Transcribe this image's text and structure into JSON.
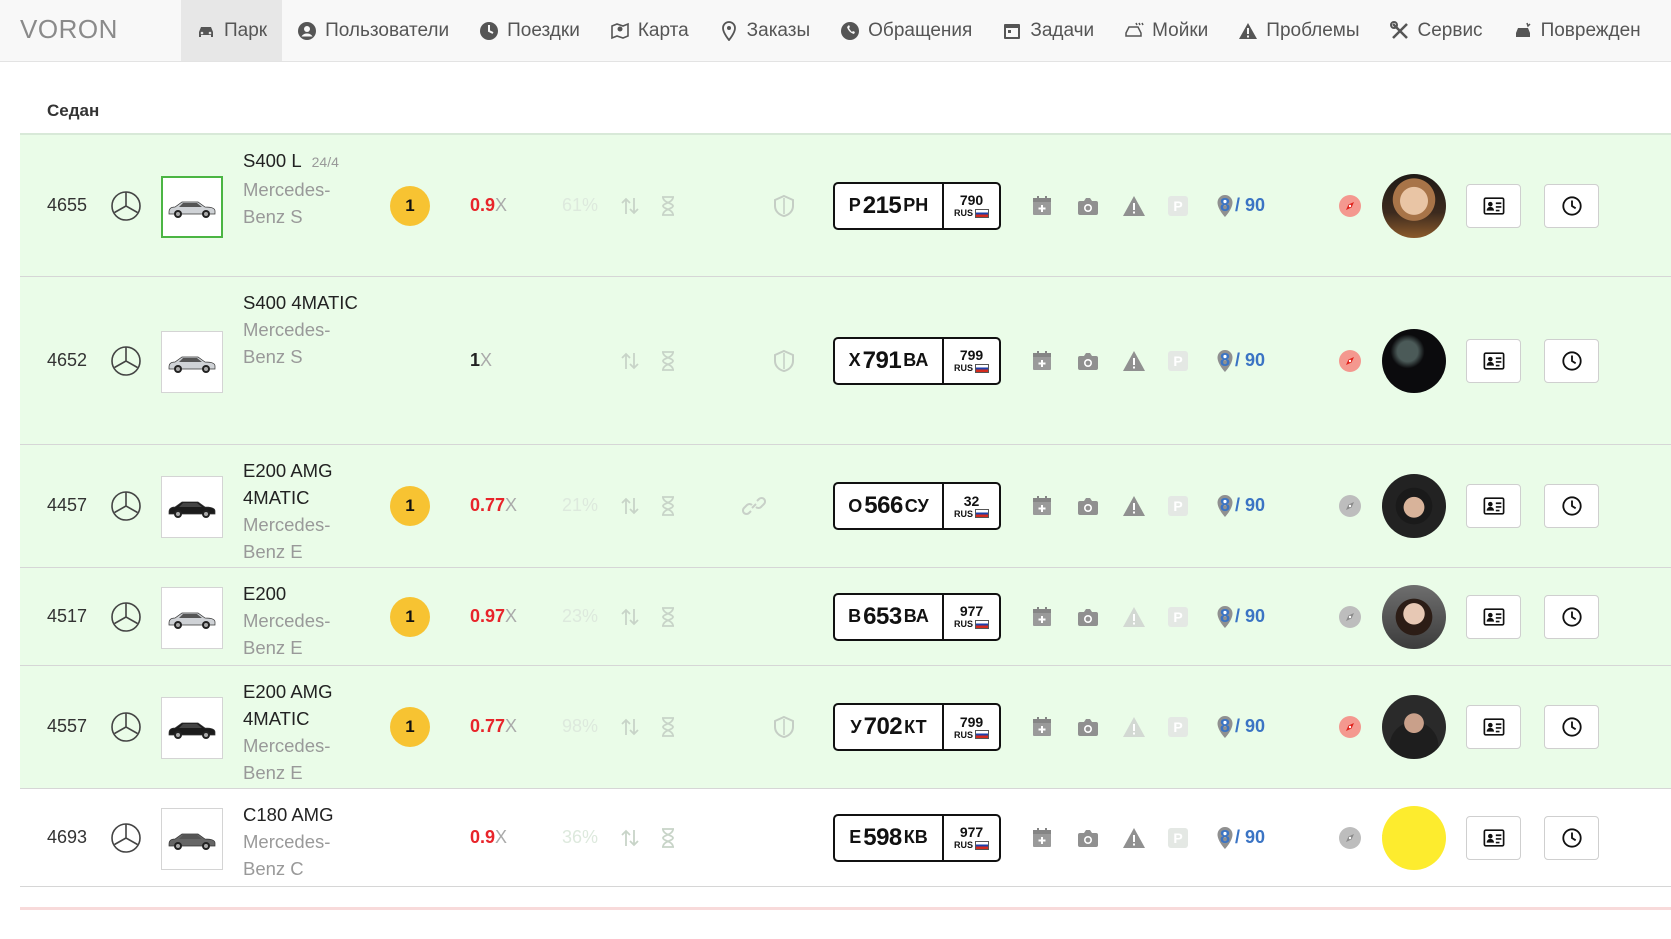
{
  "brand": "VORON",
  "nav": [
    {
      "label": "Парк",
      "icon": "car-icon",
      "active": true
    },
    {
      "label": "Пользователи",
      "icon": "user-circle-icon"
    },
    {
      "label": "Поездки",
      "icon": "clock-icon"
    },
    {
      "label": "Карта",
      "icon": "map-icon"
    },
    {
      "label": "Заказы",
      "icon": "map-pin-icon"
    },
    {
      "label": "Обращения",
      "icon": "phone-icon"
    },
    {
      "label": "Задачи",
      "icon": "calendar-icon"
    },
    {
      "label": "Мойки",
      "icon": "wash-icon"
    },
    {
      "label": "Проблемы",
      "icon": "warning-icon"
    },
    {
      "label": "Сервис",
      "icon": "tools-icon"
    },
    {
      "label": "Поврежден",
      "icon": "crash-icon"
    }
  ],
  "section": "Седан",
  "rows": [
    {
      "id": "4655",
      "model": "S400 L",
      "schedule": "24/4",
      "brand": "Mercedes-Benz S",
      "car_color": "silver",
      "selected": true,
      "badge": "1",
      "coef": "0.9",
      "coef_color": "#e8242a",
      "coef_x": "X",
      "percent": "61%",
      "shield": true,
      "link": false,
      "plate": {
        "letter1": "Р",
        "digits": "215",
        "letters2": "РН",
        "region": "790",
        "rus": "RUS"
      },
      "warning_active": true,
      "counter": "8 / 90",
      "compass": "red",
      "extra": "oil-orange",
      "avatar": "woman-blonde",
      "green": true
    },
    {
      "id": "4652",
      "model": "S400 4MATIC",
      "schedule": "",
      "brand": "Mercedes-Benz S",
      "car_color": "silver",
      "selected": false,
      "badge": "",
      "coef": "1",
      "coef_color": "#222",
      "coef_x": "X",
      "percent": "",
      "shield": true,
      "link": false,
      "plate": {
        "letter1": "Х",
        "digits": "791",
        "letters2": "ВА",
        "region": "799",
        "rus": "RUS"
      },
      "warning_active": true,
      "counter": "8 / 90",
      "compass": "red",
      "extra": "fuel-gray",
      "avatar": "dark",
      "green": true
    },
    {
      "id": "4457",
      "model": "E200 AMG 4MATIC",
      "schedule": "",
      "brand": "Mercedes-Benz E",
      "car_color": "black",
      "selected": false,
      "badge": "1",
      "coef": "0.77",
      "coef_color": "#e8242a",
      "coef_x": "X",
      "percent": "21%",
      "shield": false,
      "link": true,
      "plate": {
        "letter1": "О",
        "digits": "566",
        "letters2": "СУ",
        "region": "32",
        "rus": "RUS"
      },
      "warning_active": true,
      "counter": "8 / 90",
      "compass": "gray",
      "extra": "",
      "avatar": "man-hood",
      "green": true
    },
    {
      "id": "4517",
      "model": "E200",
      "schedule": "",
      "brand": "Mercedes-Benz E",
      "car_color": "silver",
      "selected": false,
      "badge": "1",
      "coef": "0.97",
      "coef_color": "#e8242a",
      "coef_x": "X",
      "percent": "23%",
      "shield": false,
      "link": false,
      "plate": {
        "letter1": "В",
        "digits": "653",
        "letters2": "ВА",
        "region": "977",
        "rus": "RUS"
      },
      "warning_active": false,
      "counter": "8 / 90",
      "compass": "gray",
      "extra": "",
      "avatar": "woman-brunette",
      "green": true
    },
    {
      "id": "4557",
      "model": "E200 AMG 4MATIC",
      "schedule": "",
      "brand": "Mercedes-Benz E",
      "car_color": "black",
      "selected": false,
      "badge": "1",
      "coef": "0.77",
      "coef_color": "#e8242a",
      "coef_x": "X",
      "percent": "98%",
      "shield": true,
      "link": false,
      "plate": {
        "letter1": "У",
        "digits": "702",
        "letters2": "КТ",
        "region": "799",
        "rus": "RUS"
      },
      "warning_active": false,
      "counter": "8 / 90",
      "compass": "red",
      "extra": "",
      "avatar": "man-dark",
      "green": true
    },
    {
      "id": "4693",
      "model": "C180 AMG",
      "schedule": "",
      "brand": "Mercedes-Benz C",
      "car_color": "gray",
      "selected": false,
      "badge": "",
      "coef": "0.9",
      "coef_color": "#e8242a",
      "coef_x": "X",
      "percent": "36%",
      "shield": false,
      "link": false,
      "plate": {
        "letter1": "Е",
        "digits": "598",
        "letters2": "КВ",
        "region": "977",
        "rus": "RUS"
      },
      "warning_active": true,
      "counter": "8 / 90",
      "compass": "gray",
      "extra": "oil-red",
      "avatar": "yellow",
      "green": false
    }
  ]
}
